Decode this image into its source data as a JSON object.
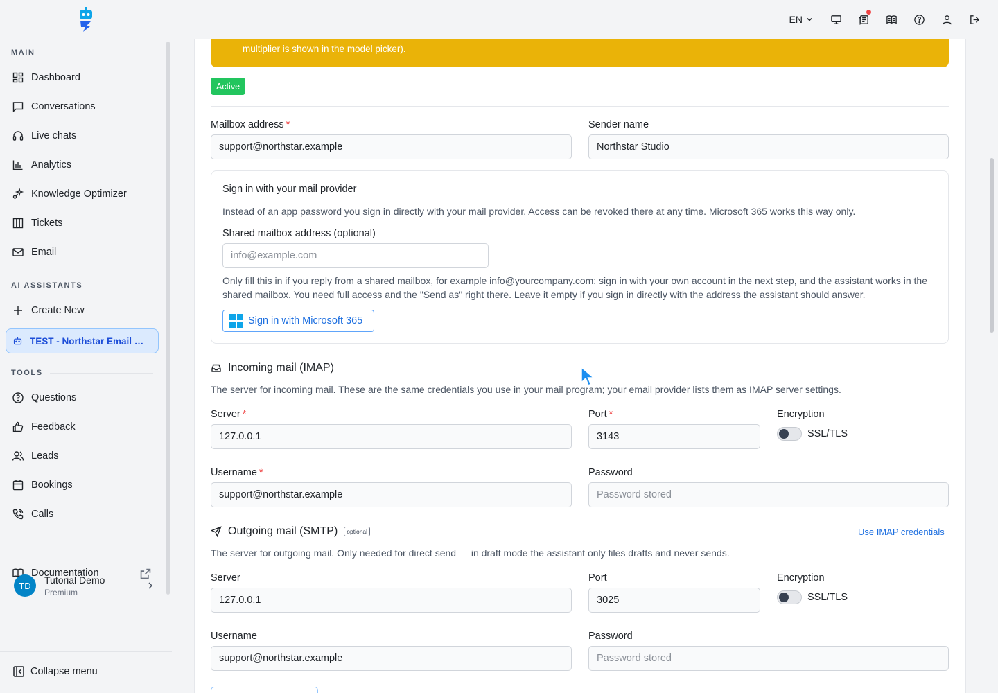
{
  "topbar": {
    "language": "EN",
    "icons": [
      "monitor-icon",
      "news-icon",
      "book-icon",
      "help-icon",
      "user-icon",
      "logout-icon"
    ]
  },
  "sidebar": {
    "main_label": "MAIN",
    "main_items": [
      {
        "label": "Dashboard",
        "icon": "dashboard-icon"
      },
      {
        "label": "Conversations",
        "icon": "chat-icon"
      },
      {
        "label": "Live chats",
        "icon": "headset-icon"
      },
      {
        "label": "Analytics",
        "icon": "bar-chart-icon"
      },
      {
        "label": "Knowledge Optimizer",
        "icon": "sparkle-icon"
      },
      {
        "label": "Tickets",
        "icon": "columns-icon"
      },
      {
        "label": "Email",
        "icon": "mail-icon"
      }
    ],
    "assistants_label": "AI ASSISTANTS",
    "create_new": "Create New",
    "active_assistant": "TEST - Northstar Email Workflow",
    "tools_label": "TOOLS",
    "tools_items": [
      {
        "label": "Questions",
        "icon": "question-icon"
      },
      {
        "label": "Feedback",
        "icon": "thumbs-up-icon"
      },
      {
        "label": "Leads",
        "icon": "users-icon"
      },
      {
        "label": "Bookings",
        "icon": "calendar-icon"
      },
      {
        "label": "Calls",
        "icon": "phone-icon"
      }
    ],
    "documentation": "Documentation",
    "user": {
      "initials": "TD",
      "name": "Tutorial Demo",
      "plan": "Premium"
    },
    "collapse": "Collapse menu"
  },
  "main": {
    "warning_text": "multiplier is shown in the model picker).",
    "status_badge": "Active",
    "mailbox_label": "Mailbox address",
    "mailbox_value": "support@northstar.example",
    "sender_label": "Sender name",
    "sender_value": "Northstar Studio",
    "oauth": {
      "title": "Sign in with your mail provider",
      "description": "Instead of an app password you sign in directly with your mail provider. Access can be revoked there at any time. Microsoft 365 works this way only.",
      "shared_label": "Shared mailbox address (optional)",
      "shared_placeholder": "info@example.com",
      "shared_help": "Only fill this in if you reply from a shared mailbox, for example info@yourcompany.com: sign in with your own account in the next step, and the assistant works in the shared mailbox. You need full access and the \"Send as\" right there. Leave it empty if you sign in directly with the address the assistant should answer.",
      "ms_button": "Sign in with Microsoft 365"
    },
    "imap": {
      "title": "Incoming mail (IMAP)",
      "description": "The server for incoming mail. These are the same credentials you use in your mail program; your email provider lists them as IMAP server settings.",
      "server_label": "Server",
      "server_value": "127.0.0.1",
      "port_label": "Port",
      "port_value": "3143",
      "encryption_label": "Encryption",
      "encryption_toggle": "SSL/TLS",
      "username_label": "Username",
      "username_value": "support@northstar.example",
      "password_label": "Password",
      "password_placeholder": "Password stored"
    },
    "smtp": {
      "title": "Outgoing mail (SMTP)",
      "optional_badge": "optional",
      "use_imap_link": "Use IMAP credentials",
      "description": "The server for outgoing mail. Only needed for direct send — in draft mode the assistant only files drafts and never sends.",
      "server_label": "Server",
      "server_value": "127.0.0.1",
      "port_label": "Port",
      "port_value": "3025",
      "encryption_label": "Encryption",
      "encryption_toggle": "SSL/TLS",
      "username_label": "Username",
      "username_value": "support@northstar.example",
      "password_label": "Password",
      "password_placeholder": "Password stored"
    }
  }
}
